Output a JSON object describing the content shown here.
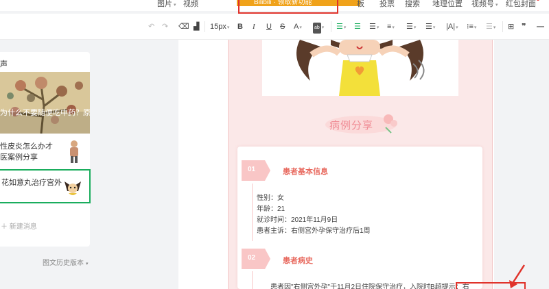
{
  "menu": {
    "items": [
      "图片",
      "视频",
      "板",
      "投票",
      "搜索",
      "地理位置",
      "视频号",
      "红包封面"
    ],
    "banner_text": "Bilibili · 领取新功能"
  },
  "toolbar": {
    "undo_icon": "undo-icon",
    "redo_icon": "redo-icon",
    "font_size": "15px",
    "bold": "B",
    "italic": "I",
    "underline": "U",
    "strike": "S",
    "font_color": "A",
    "highlight": "ab",
    "quote": "❞"
  },
  "left_panel": {
    "title": "声",
    "cover_title": "为什么不要随便吃中药？原因在这",
    "articles": [
      {
        "title": "性皮炎怎么办才\n医案例分享"
      },
      {
        "title": "花如意丸治疗宫外"
      }
    ],
    "new_message": "新建消息",
    "history": "图文历史版本"
  },
  "article": {
    "section_title": "病例分享",
    "sections": [
      {
        "number": "01",
        "heading": "患者基本信息"
      },
      {
        "number": "02",
        "heading": "患者病史"
      }
    ],
    "info": [
      "性别：女",
      "年龄：21",
      "就诊时间：2021年11月9日",
      "患者主诉：右侧宫外孕保守治疗后1周"
    ],
    "history_paragraph": "患者因\"右侧宫外孕\"于11月2日住院保守治疗，入院时B超提示：右"
  },
  "colors": {
    "accent_green": "#1aad5d",
    "pink_page": "#fbe8e8",
    "heading_red": "#e86a5f",
    "highlight_red": "#e0332b"
  }
}
